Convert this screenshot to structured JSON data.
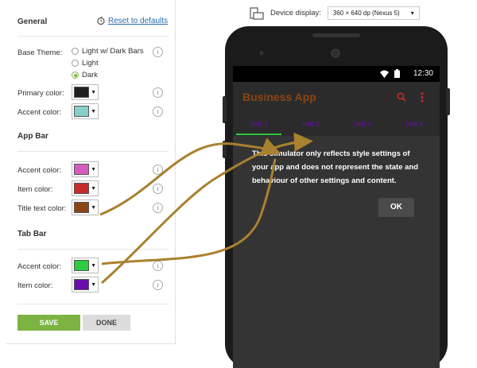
{
  "settings": {
    "general_title": "General",
    "reset_label": "Reset to defaults",
    "base_theme": {
      "label": "Base Theme:",
      "options": [
        "Light w/ Dark Bars",
        "Light",
        "Dark"
      ],
      "selected": "Dark"
    },
    "primary_color": {
      "label": "Primary color:",
      "color": "#1f1f1f"
    },
    "accent_color": {
      "label": "Accent color:",
      "color": "#86d0c9"
    },
    "app_bar_title": "App Bar",
    "appbar_accent": {
      "label": "Accent color:",
      "color": "#d65dbe"
    },
    "appbar_item": {
      "label": "Item color:",
      "color": "#c62a2a"
    },
    "appbar_title_text": {
      "label": "Title text color:",
      "color": "#8b4513"
    },
    "tab_bar_title": "Tab Bar",
    "tab_accent": {
      "label": "Accent color:",
      "color": "#2ecc40"
    },
    "tab_item": {
      "label": "Item color:",
      "color": "#6a0dad"
    },
    "info_glyph": "i",
    "save_label": "SAVE",
    "done_label": "DONE"
  },
  "device": {
    "label": "Device display:",
    "selected": "360 × 640 dp (Nexus 5)"
  },
  "phone": {
    "time": "12:30",
    "app_title": "Business App",
    "tabs": [
      "TAB 1",
      "TAB 2",
      "TAB 3",
      "TAB 4"
    ],
    "message": "This simulator only reflects style settings of your app and does not represent the state and behaviour of other settings and content.",
    "ok_label": "OK"
  }
}
